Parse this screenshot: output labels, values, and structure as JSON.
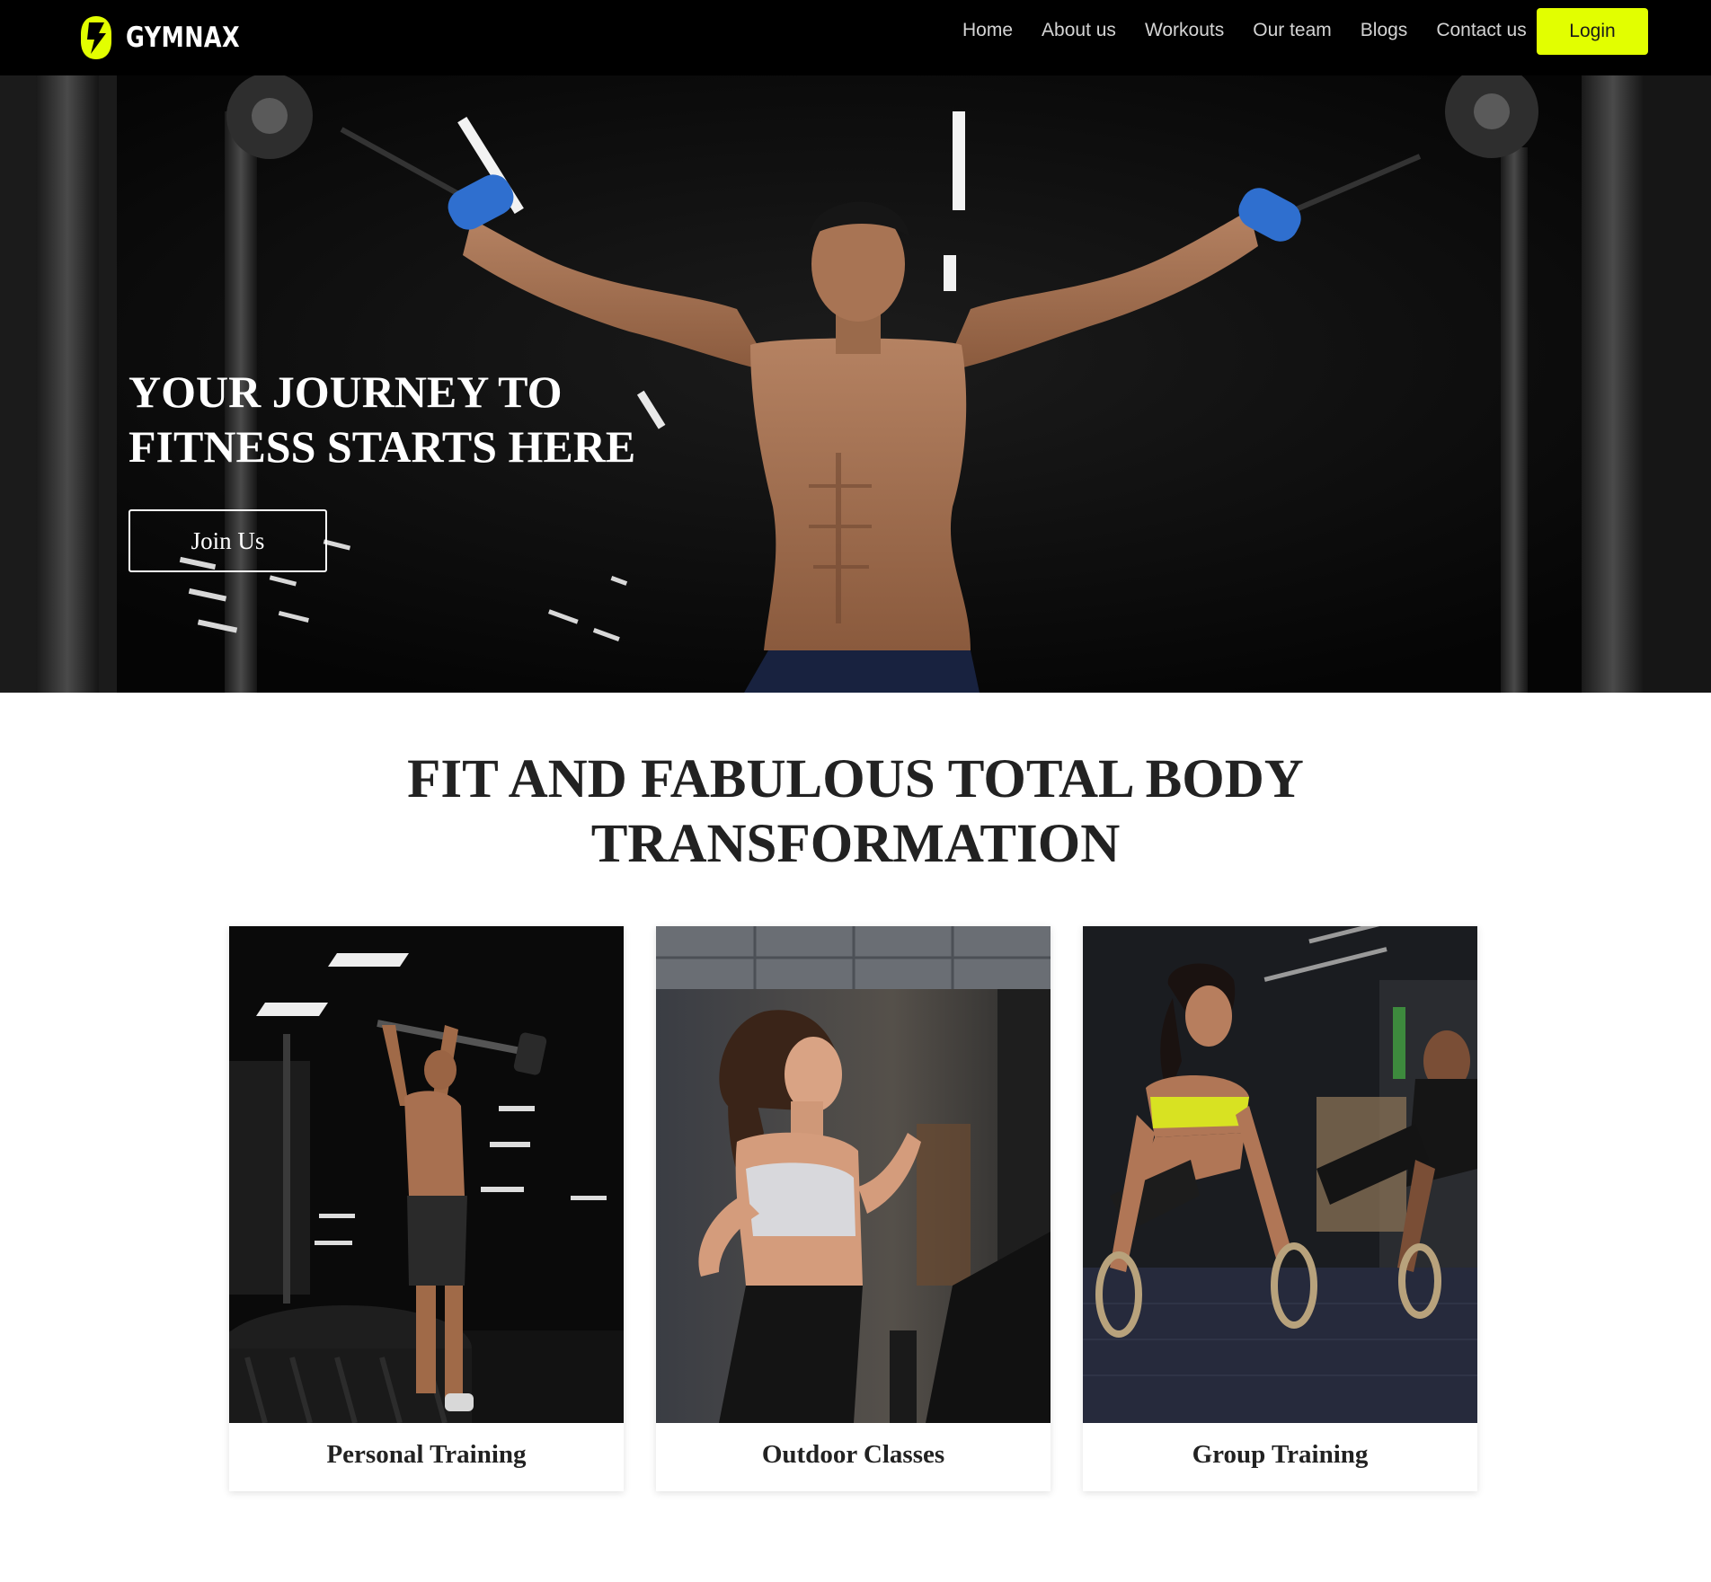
{
  "navbar": {
    "brand": "GYMNAX",
    "links": [
      "Home",
      "About us",
      "Workouts",
      "Our team",
      "Blogs",
      "Contact us"
    ],
    "login_label": "Login"
  },
  "hero": {
    "title_line1": "YOUR JOURNEY TO",
    "title_line2": "FITNESS STARTS HERE",
    "cta_label": "Join Us"
  },
  "section": {
    "title_line1": "FIT AND FABULOUS TOTAL BODY",
    "title_line2": "TRANSFORMATION"
  },
  "cards": [
    {
      "title": "Personal Training"
    },
    {
      "title": "Outdoor Classes"
    },
    {
      "title": "Group Training"
    }
  ],
  "colors": {
    "accent": "#e2ff00",
    "navbar_bg": "#000000",
    "heading": "#222222"
  }
}
